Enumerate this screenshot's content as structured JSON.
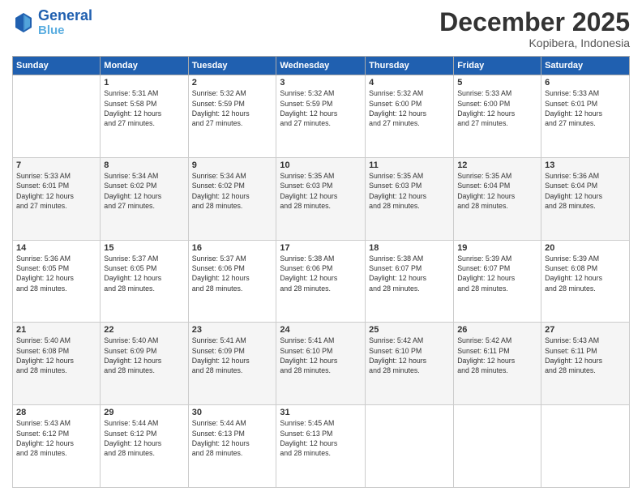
{
  "header": {
    "logo_line1": "General",
    "logo_line2": "Blue",
    "month": "December 2025",
    "location": "Kopibera, Indonesia"
  },
  "days_of_week": [
    "Sunday",
    "Monday",
    "Tuesday",
    "Wednesday",
    "Thursday",
    "Friday",
    "Saturday"
  ],
  "weeks": [
    [
      {
        "day": "",
        "info": ""
      },
      {
        "day": "1",
        "info": "Sunrise: 5:31 AM\nSunset: 5:58 PM\nDaylight: 12 hours\nand 27 minutes."
      },
      {
        "day": "2",
        "info": "Sunrise: 5:32 AM\nSunset: 5:59 PM\nDaylight: 12 hours\nand 27 minutes."
      },
      {
        "day": "3",
        "info": "Sunrise: 5:32 AM\nSunset: 5:59 PM\nDaylight: 12 hours\nand 27 minutes."
      },
      {
        "day": "4",
        "info": "Sunrise: 5:32 AM\nSunset: 6:00 PM\nDaylight: 12 hours\nand 27 minutes."
      },
      {
        "day": "5",
        "info": "Sunrise: 5:33 AM\nSunset: 6:00 PM\nDaylight: 12 hours\nand 27 minutes."
      },
      {
        "day": "6",
        "info": "Sunrise: 5:33 AM\nSunset: 6:01 PM\nDaylight: 12 hours\nand 27 minutes."
      }
    ],
    [
      {
        "day": "7",
        "info": "Sunrise: 5:33 AM\nSunset: 6:01 PM\nDaylight: 12 hours\nand 27 minutes."
      },
      {
        "day": "8",
        "info": "Sunrise: 5:34 AM\nSunset: 6:02 PM\nDaylight: 12 hours\nand 27 minutes."
      },
      {
        "day": "9",
        "info": "Sunrise: 5:34 AM\nSunset: 6:02 PM\nDaylight: 12 hours\nand 28 minutes."
      },
      {
        "day": "10",
        "info": "Sunrise: 5:35 AM\nSunset: 6:03 PM\nDaylight: 12 hours\nand 28 minutes."
      },
      {
        "day": "11",
        "info": "Sunrise: 5:35 AM\nSunset: 6:03 PM\nDaylight: 12 hours\nand 28 minutes."
      },
      {
        "day": "12",
        "info": "Sunrise: 5:35 AM\nSunset: 6:04 PM\nDaylight: 12 hours\nand 28 minutes."
      },
      {
        "day": "13",
        "info": "Sunrise: 5:36 AM\nSunset: 6:04 PM\nDaylight: 12 hours\nand 28 minutes."
      }
    ],
    [
      {
        "day": "14",
        "info": "Sunrise: 5:36 AM\nSunset: 6:05 PM\nDaylight: 12 hours\nand 28 minutes."
      },
      {
        "day": "15",
        "info": "Sunrise: 5:37 AM\nSunset: 6:05 PM\nDaylight: 12 hours\nand 28 minutes."
      },
      {
        "day": "16",
        "info": "Sunrise: 5:37 AM\nSunset: 6:06 PM\nDaylight: 12 hours\nand 28 minutes."
      },
      {
        "day": "17",
        "info": "Sunrise: 5:38 AM\nSunset: 6:06 PM\nDaylight: 12 hours\nand 28 minutes."
      },
      {
        "day": "18",
        "info": "Sunrise: 5:38 AM\nSunset: 6:07 PM\nDaylight: 12 hours\nand 28 minutes."
      },
      {
        "day": "19",
        "info": "Sunrise: 5:39 AM\nSunset: 6:07 PM\nDaylight: 12 hours\nand 28 minutes."
      },
      {
        "day": "20",
        "info": "Sunrise: 5:39 AM\nSunset: 6:08 PM\nDaylight: 12 hours\nand 28 minutes."
      }
    ],
    [
      {
        "day": "21",
        "info": "Sunrise: 5:40 AM\nSunset: 6:08 PM\nDaylight: 12 hours\nand 28 minutes."
      },
      {
        "day": "22",
        "info": "Sunrise: 5:40 AM\nSunset: 6:09 PM\nDaylight: 12 hours\nand 28 minutes."
      },
      {
        "day": "23",
        "info": "Sunrise: 5:41 AM\nSunset: 6:09 PM\nDaylight: 12 hours\nand 28 minutes."
      },
      {
        "day": "24",
        "info": "Sunrise: 5:41 AM\nSunset: 6:10 PM\nDaylight: 12 hours\nand 28 minutes."
      },
      {
        "day": "25",
        "info": "Sunrise: 5:42 AM\nSunset: 6:10 PM\nDaylight: 12 hours\nand 28 minutes."
      },
      {
        "day": "26",
        "info": "Sunrise: 5:42 AM\nSunset: 6:11 PM\nDaylight: 12 hours\nand 28 minutes."
      },
      {
        "day": "27",
        "info": "Sunrise: 5:43 AM\nSunset: 6:11 PM\nDaylight: 12 hours\nand 28 minutes."
      }
    ],
    [
      {
        "day": "28",
        "info": "Sunrise: 5:43 AM\nSunset: 6:12 PM\nDaylight: 12 hours\nand 28 minutes."
      },
      {
        "day": "29",
        "info": "Sunrise: 5:44 AM\nSunset: 6:12 PM\nDaylight: 12 hours\nand 28 minutes."
      },
      {
        "day": "30",
        "info": "Sunrise: 5:44 AM\nSunset: 6:13 PM\nDaylight: 12 hours\nand 28 minutes."
      },
      {
        "day": "31",
        "info": "Sunrise: 5:45 AM\nSunset: 6:13 PM\nDaylight: 12 hours\nand 28 minutes."
      },
      {
        "day": "",
        "info": ""
      },
      {
        "day": "",
        "info": ""
      },
      {
        "day": "",
        "info": ""
      }
    ]
  ]
}
